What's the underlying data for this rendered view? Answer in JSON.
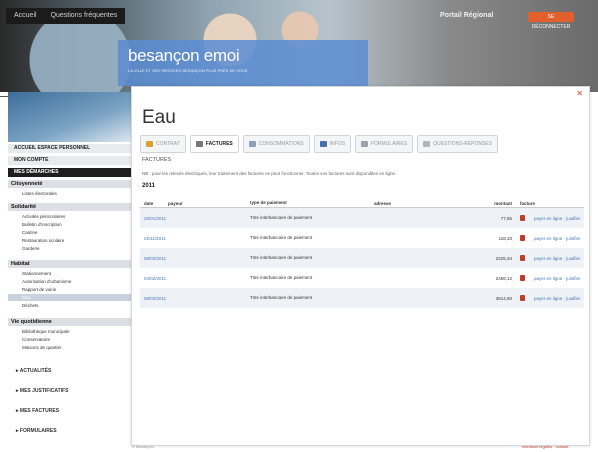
{
  "header": {
    "nav": [
      "Accueil",
      "Questions fréquentes"
    ],
    "portal_label": "Portail Régional",
    "portal_button": "SE DÉCONNECTER",
    "brand_name": "besançon emoi",
    "brand_tagline": "LA VILLE ET SES SERVICES BESANÇON PLUS PRÈS DE VOUS"
  },
  "sidebar": {
    "accueil": "ACCUEIL ESPACE PERSONNEL",
    "mon_compte": "MON COMPTE",
    "mes_demarches": "MES DÉMARCHES",
    "sections": [
      {
        "label": "Citoyenneté",
        "items": [
          "Listes électorales"
        ]
      },
      {
        "label": "Solidarité",
        "items": [
          "Activités périscolaires",
          "Bulletin d'inscription",
          "Cantine",
          "Restauration scolaire",
          "Garderie"
        ]
      },
      {
        "label": "Habitat",
        "items": [
          "Stationnement",
          "Autorisation d'urbanisme",
          "Rapport de voirie",
          "Eau",
          "Déchets"
        ]
      },
      {
        "label": "Vie quotidienne",
        "items": [
          "Bibliothèque municipale",
          "Conservatoire",
          "Maisons de quartier"
        ]
      }
    ],
    "bottom_links": [
      "ACTUALITÉS",
      "MES JUSTIFICATIFS",
      "MES FACTURES",
      "FORMULAIRES"
    ]
  },
  "panel": {
    "title": "Eau",
    "tabs": [
      {
        "label": "CONTRAT",
        "color": "#e0a030",
        "active": false
      },
      {
        "label": "FACTURES",
        "color": "#777777",
        "active": true
      },
      {
        "label": "CONSOMMATIONS",
        "color": "#8aa0b8",
        "active": false
      },
      {
        "label": "INFOS",
        "color": "#4a6fb0",
        "active": false
      },
      {
        "label": "FORMULAIRES",
        "color": "#9aa4ad",
        "active": false
      },
      {
        "label": "QUESTIONS-RÉPONSES",
        "color": "#b0b6bc",
        "active": false
      }
    ],
    "section_label": "FACTURES",
    "info_text": "NB : pour les relevés électriques, leur traitement des factures ne peut fonctionner. Toutes vos factures sont disponibles en ligne.",
    "year": "2011",
    "columns": [
      "date",
      "payeur",
      "type de paiement",
      "adresse",
      "montant",
      "facture"
    ],
    "rows": [
      {
        "date": "20/01/2011",
        "payeur": "",
        "type": "Titre interbancaire de paiement",
        "adresse": "",
        "montant": "77,55",
        "links": "payer en ligne · justifier"
      },
      {
        "date": "02/11/2011",
        "payeur": "",
        "type": "Titre interbancaire de paiement",
        "adresse": "",
        "montant": "118,33",
        "links": "payer en ligne · justifier"
      },
      {
        "date": "08/03/2011",
        "payeur": "",
        "type": "Titre interbancaire de paiement",
        "adresse": "",
        "montant": "2225,34",
        "links": "payer en ligne · justifier"
      },
      {
        "date": "04/02/2011",
        "payeur": "",
        "type": "Titre interbancaire de paiement",
        "adresse": "",
        "montant": "2468,12",
        "links": "payer en ligne · justifier"
      },
      {
        "date": "08/03/2011",
        "payeur": "",
        "type": "Titre interbancaire de paiement",
        "adresse": "",
        "montant": "3814,50",
        "links": "payer en ligne · justifier"
      }
    ]
  },
  "footer": {
    "left": "© Besançon",
    "right": "mentions légales · contact"
  }
}
